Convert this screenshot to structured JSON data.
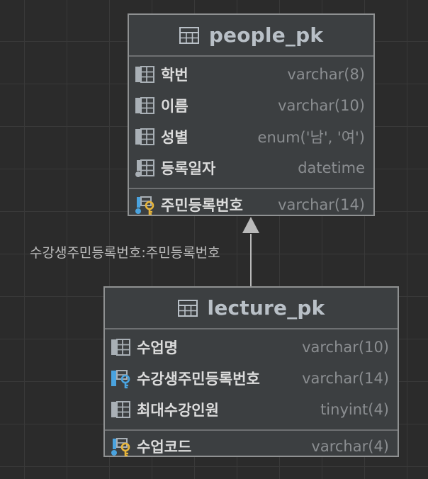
{
  "tables": {
    "people": {
      "title": "people_pk",
      "columns": [
        {
          "name": "학번",
          "type": "varchar(8)",
          "icon": "column-icon"
        },
        {
          "name": "이름",
          "type": "varchar(10)",
          "icon": "column-icon"
        },
        {
          "name": "성별",
          "type": "enum('남', '여')",
          "icon": "column-icon"
        },
        {
          "name": "등록일자",
          "type": "datetime",
          "icon": "nullable-column-icon"
        }
      ],
      "primary_key": {
        "name": "주민등록번호",
        "type": "varchar(14)",
        "icon": "primary-key-icon"
      }
    },
    "lecture": {
      "title": "lecture_pk",
      "columns": [
        {
          "name": "수업명",
          "type": "varchar(10)",
          "icon": "column-icon"
        },
        {
          "name": "수강생주민등록번호",
          "type": "varchar(14)",
          "icon": "foreign-key-icon"
        },
        {
          "name": "최대수강인원",
          "type": "tinyint(4)",
          "icon": "column-icon"
        }
      ],
      "primary_key": {
        "name": "수업코드",
        "type": "varchar(4)",
        "icon": "primary-key-icon"
      }
    }
  },
  "relationship": {
    "label": "수강생주민등록번호:주민등록번호",
    "from": "lecture_pk",
    "to": "people_pk"
  },
  "colors": {
    "background": "#2b2b2b",
    "table_fill": "#3c3f41",
    "primary_key": "#e8b53a",
    "foreign_key": "#4aa3df",
    "connector": "#b9b9b9"
  }
}
